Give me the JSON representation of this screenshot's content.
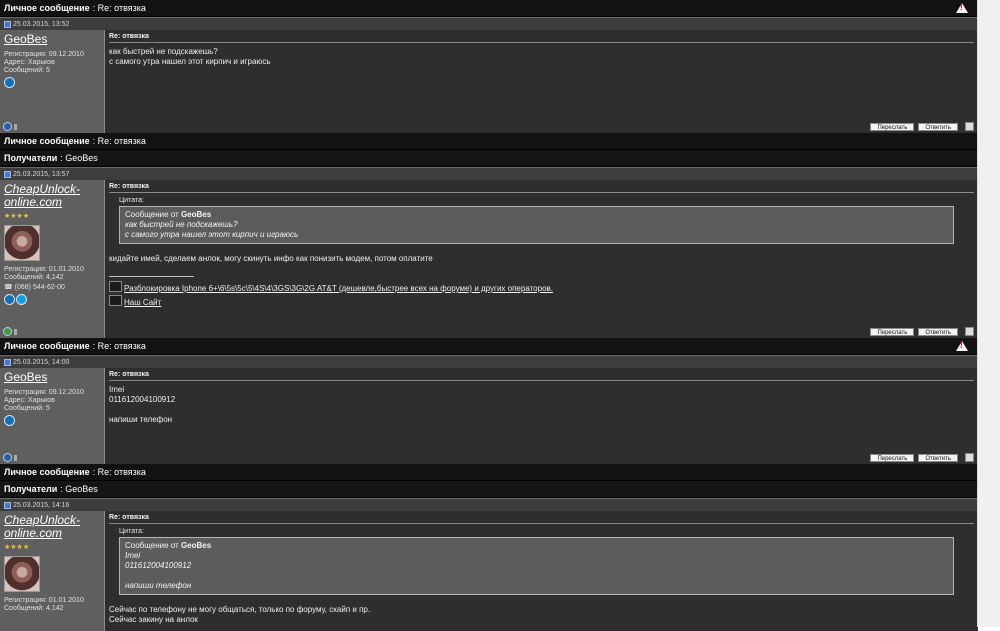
{
  "posts": [
    {
      "pm_header": {
        "label": "Личное сообщение",
        "subject": "Re: отвязка",
        "has_warning": true
      },
      "recipients": null,
      "date": "25.03.2015, 13:52",
      "user": {
        "name": "GeoBes",
        "italic": false,
        "meta": [
          "Регистрация: 09.12.2010",
          "Адрес: Харьков",
          "Сообщений: 5"
        ]
      },
      "title": "Re: отвязка",
      "text": "как быстрей не подскажешь?\nс самого утра нашел этот кирпич и играюсь",
      "quote": null,
      "signature": null
    },
    {
      "pm_header": {
        "label": "Личное сообщение",
        "subject": "Re: отвязка",
        "has_warning": false
      },
      "recipients": {
        "label": "Получатели",
        "value": "GeoBes"
      },
      "date": "25.03.2015, 13:57",
      "user": {
        "name": "CheapUnlock-online.com",
        "italic": true,
        "stars": "★★★★",
        "meta": [
          "Регистрация: 01.01.2010",
          "Сообщений: 4,142"
        ],
        "phone": "☎ (068) 544-62-00"
      },
      "title": "Re: отвязка",
      "quote": {
        "label": "Цитата:",
        "from_label": "Сообщение от",
        "from_user": "GeoBes",
        "text": "как быстрей не подскажешь?\nс самого утра нашел этот кирпич и играюсь"
      },
      "text": "кидайте имей, сделаем анлок, могу скинуть инфо как понизить модем, потом оплатите",
      "signature": [
        "Разблокировка Iphone 6+\\6\\5s\\5c\\5\\4S\\4\\3GS\\3G\\2G AT&T (дешевле,быстрее всех на форуме) и других операторов.",
        "Наш Сайт"
      ]
    },
    {
      "pm_header": {
        "label": "Личное сообщение",
        "subject": "Re: отвязка",
        "has_warning": true
      },
      "recipients": null,
      "date": "25.03.2015, 14:00",
      "user": {
        "name": "GeoBes",
        "italic": false,
        "meta": [
          "Регистрация: 09.12.2010",
          "Адрес: Харьков",
          "Сообщений: 5"
        ]
      },
      "title": "Re: отвязка",
      "text": "Imei\n011612004100912\n\nнапиши телефон",
      "quote": null,
      "signature": null
    },
    {
      "pm_header": {
        "label": "Личное сообщение",
        "subject": "Re: отвязка",
        "has_warning": false
      },
      "recipients": {
        "label": "Получатели",
        "value": "GeoBes"
      },
      "date": "25.03.2015, 14:16",
      "user": {
        "name": "CheapUnlock-online.com",
        "italic": true,
        "stars": "★★★★",
        "meta": [
          "Регистрация: 01.01.2010",
          "Сообщений: 4,142"
        ]
      },
      "title": "Re: отвязка",
      "quote": {
        "label": "Цитата:",
        "from_label": "Сообщение от",
        "from_user": "GeoBes",
        "text": "Imei\n011612004100912\n\nнапиши телефон"
      },
      "text": "Сейчас по телефону не могу общаться, только по форуму, скайп и пр.\nСейчас закину на анлок",
      "signature": null
    }
  ],
  "buttons": {
    "forward": "Переслать",
    "reply": "Ответить"
  },
  "colors": {
    "header_bg": "#121212",
    "user_col_bg": "#5f5f5f",
    "msg_bg": "#2e2e2e",
    "quote_bg": "#5c5c5c",
    "star": "#e8c23a"
  }
}
